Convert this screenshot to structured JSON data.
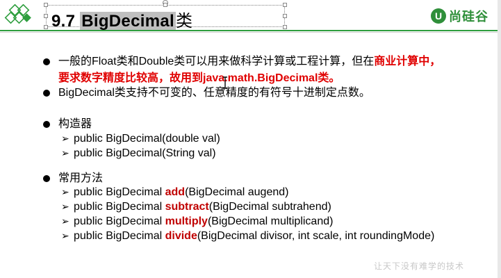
{
  "header": {
    "title_number": "9.7",
    "title_keyword": "BigDecimal",
    "title_suffix": "类",
    "brand_mark": "U",
    "brand_text": "尚硅谷"
  },
  "bullets": [
    {
      "parts": [
        {
          "text": "一般的Float类和Double类可以用来做科学计算或工程计算，但在",
          "style": "normal"
        },
        {
          "text": "商业计算中，",
          "style": "red"
        }
      ]
    },
    {
      "parts": [
        {
          "text": "要求数字精度比较高，故用到java.math.BigDecimal类。",
          "style": "red"
        }
      ]
    },
    {
      "parts": [
        {
          "text": "BigDecimal类支持不可变的、任意精度的有符号十进制定点数。",
          "style": "normal"
        }
      ]
    }
  ],
  "constructors": {
    "heading": "构造器",
    "items": [
      "public BigDecimal(double val)",
      "public BigDecimal(String val)"
    ]
  },
  "methods": {
    "heading": "常用方法",
    "items": [
      {
        "prefix": "public BigDecimal ",
        "name": "add",
        "args": "(BigDecimal augend)"
      },
      {
        "prefix": "public BigDecimal ",
        "name": "subtract",
        "args": "(BigDecimal subtrahend)"
      },
      {
        "prefix": "public BigDecimal ",
        "name": "multiply",
        "args": "(BigDecimal multiplicand)"
      },
      {
        "prefix": "public BigDecimal ",
        "name": "divide",
        "args": "(BigDecimal divisor, int scale, int roundingMode)"
      }
    ]
  },
  "watermark": "让天下没有难学的技术",
  "colors": {
    "accent_green": "#2e9e3e",
    "keyword_red": "#c00000",
    "highlight_red": "#e00000"
  },
  "icons": {
    "logo": "diamond-logo-icon",
    "bullet": "bullet-dot-icon",
    "arrow": "arrow-bullet-icon",
    "cursor": "text-cursor-icon"
  }
}
